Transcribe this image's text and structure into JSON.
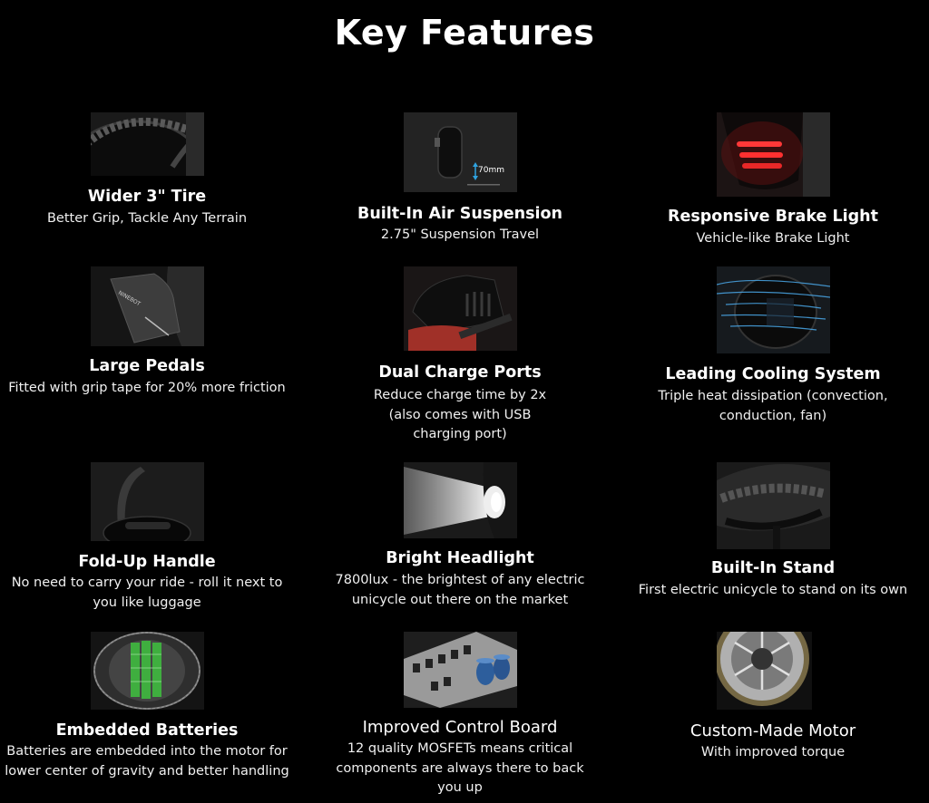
{
  "page_title": "Key Features",
  "features": [
    {
      "icon": "tire-image",
      "title": "Wider 3\" Tire",
      "description": "Better Grip, Tackle Any Terrain"
    },
    {
      "icon": "air-suspension-image",
      "title": "Built-In Air Suspension",
      "description": "2.75\" Suspension Travel",
      "image_label": "70mm"
    },
    {
      "icon": "brake-light-image",
      "title": "Responsive Brake Light",
      "description": "Vehicle-like Brake Light"
    },
    {
      "icon": "pedal-image",
      "title": "Large Pedals",
      "description": "Fitted with grip tape for 20% more friction"
    },
    {
      "icon": "charge-port-image",
      "title": "Dual Charge Ports",
      "description": "Reduce charge time by 2x (also comes with USB charging port)"
    },
    {
      "icon": "cooling-system-image",
      "title": "Leading Cooling System",
      "description": "Triple heat dissipation (convection, conduction, fan)"
    },
    {
      "icon": "handle-image",
      "title": "Fold-Up Handle",
      "description": "No need to carry your ride - roll it next to you like luggage"
    },
    {
      "icon": "headlight-image",
      "title": "Bright Headlight",
      "description": "7800lux - the brightest of any electric unicycle out there on the market"
    },
    {
      "icon": "stand-image",
      "title": "Built-In Stand",
      "description": "First electric unicycle to stand on its own"
    },
    {
      "icon": "battery-image",
      "title": "Embedded Batteries",
      "description": "Batteries are embedded into the motor for lower center of gravity and better handling"
    },
    {
      "icon": "control-board-image",
      "title": "Improved Control Board",
      "description": "12 quality MOSFETs means critical components are always there to back you up"
    },
    {
      "icon": "motor-image",
      "title": "Custom-Made Motor",
      "description": "With improved torque"
    }
  ]
}
